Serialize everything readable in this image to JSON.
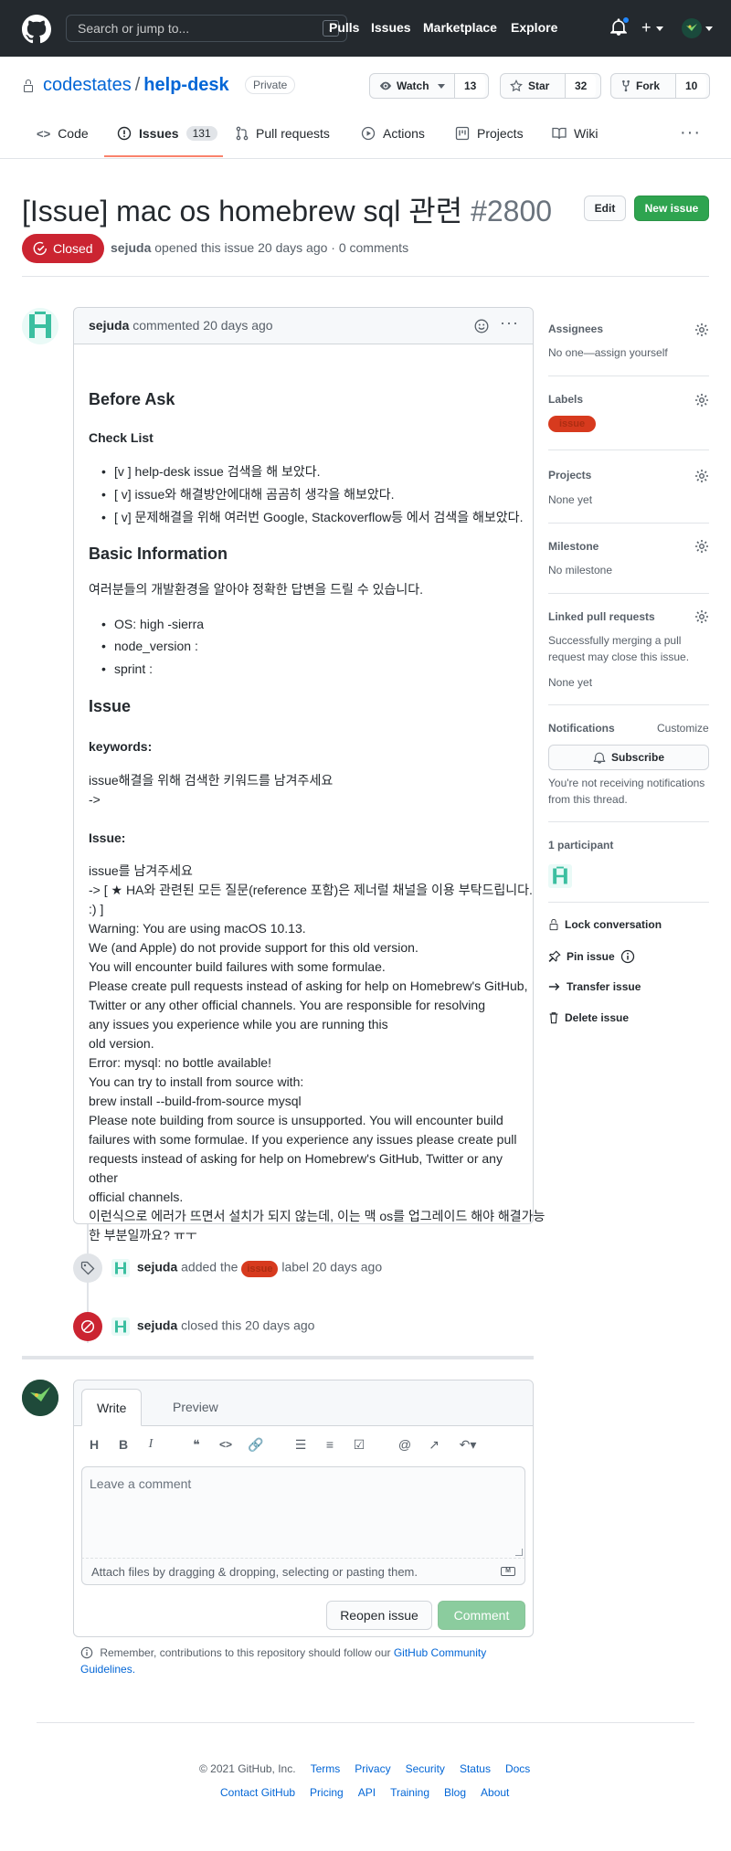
{
  "header": {
    "search_placeholder": "Search or jump to...",
    "search_key": "/",
    "nav": [
      "Pulls",
      "Issues",
      "Marketplace",
      "Explore"
    ]
  },
  "repo": {
    "owner": "codestates",
    "separator": "/",
    "name": "help-desk",
    "visibility": "Private",
    "watch_label": "Watch",
    "watch_count": "13",
    "star_label": "Star",
    "star_count": "32",
    "fork_label": "Fork",
    "fork_count": "10"
  },
  "repo_nav": {
    "code": "Code",
    "issues": "Issues",
    "issues_count": "131",
    "pulls": "Pull requests",
    "actions": "Actions",
    "projects": "Projects",
    "wiki": "Wiki"
  },
  "issue": {
    "title": "[Issue] mac os homebrew sql 관련",
    "number": "#2800",
    "edit_label": "Edit",
    "new_issue_label": "New issue",
    "state": "Closed",
    "author": "sejuda",
    "meta": "opened this issue 20 days ago · 0 comments"
  },
  "comment": {
    "author": "sejuda",
    "meta": "commented 20 days ago",
    "lines": {
      "before_ask": "Before Ask",
      "check_list": "Check List",
      "c1": "[v ] help-desk issue 검색을 해 보았다.",
      "c2": "[ v] issue와 해결방안에대해 곰곰히 생각을 해보았다.",
      "c3": "[ v] 문제해결을 위해 여러번 Google, Stackoverflow등 에서 검색을 해보았다.",
      "basic_info": "Basic Information",
      "basic_desc": "여러분들의 개발환경을 알아야 정확한 답변을 드릴 수 있습니다.",
      "os": "OS: high -sierra",
      "node": "node_version :",
      "sprint": "sprint :",
      "issue_h": "Issue",
      "keywords_h": "keywords:",
      "keywords_1": "issue해결을 위해 검색한 키워드를 남겨주세요",
      "keywords_2": "->",
      "issue_h2": "Issue:",
      "i1": "issue를 남겨주세요",
      "i2": "-> [ ★ HA와 관련된 모든 질문(reference 포함)은 제너럴 채널을 이용 부탁드립니다.",
      "i3": ":) ]",
      "i4": "Warning: You are using macOS 10.13.",
      "i5": "We (and Apple) do not provide support for this old version.",
      "i6": "You will encounter build failures with some formulae.",
      "i7": "Please create pull requests instead of asking for help on Homebrew's GitHub,",
      "i8": "Twitter or any other official channels. You are responsible for resolving",
      "i9": "any issues you experience while you are running this",
      "i10": "old version.",
      "i11": "Error: mysql: no bottle available!",
      "i12": "You can try to install from source with:",
      "i13": "brew install --build-from-source mysql",
      "i14": "Please note building from source is unsupported. You will encounter build",
      "i15": "failures with some formulae. If you experience any issues please create pull",
      "i16": "requests instead of asking for help on Homebrew's GitHub, Twitter or any",
      "i17": "other",
      "i18": "official channels.",
      "i19": "이런식으로 에러가 뜨면서 설치가 되지 않는데, 이는 맥 os를 업그레이드 해야 해결가능",
      "i20": "한 부분일까요? ㅠㅜ"
    }
  },
  "sidebar": {
    "assignees_h": "Assignees",
    "assignees_v": "No one—assign yourself",
    "labels_h": "Labels",
    "label_name": "issue",
    "projects_h": "Projects",
    "projects_v": "None yet",
    "milestone_h": "Milestone",
    "milestone_v": "No milestone",
    "linked_h": "Linked pull requests",
    "linked_desc1": "Successfully merging a pull",
    "linked_desc2": "request may close this issue.",
    "linked_v": "None yet",
    "notif_h": "Notifications",
    "customize": "Customize",
    "subscribe": "Subscribe",
    "notif_desc1": "You're not receiving notifications",
    "notif_desc2": "from this thread.",
    "participants": "1 participant",
    "lock": "Lock conversation",
    "pin": "Pin issue",
    "transfer": "Transfer issue",
    "delete": "Delete issue"
  },
  "timeline": {
    "label_event_user": "sejuda",
    "label_event_pre": "added the",
    "label_event_label": "issue",
    "label_event_post": "label 20 days ago",
    "closed_user": "sejuda",
    "closed_text": "closed this 20 days ago"
  },
  "compose": {
    "write_tab": "Write",
    "preview_tab": "Preview",
    "placeholder": "Leave a comment",
    "attach_hint": "Attach files by dragging & dropping, selecting or pasting them.",
    "reopen": "Reopen issue",
    "comment": "Comment",
    "remember_pre": "Remember, contributions to this repository should follow our",
    "guidelines_1": "GitHub Community",
    "guidelines_2": "Guidelines."
  },
  "footer": {
    "copyright": "© 2021 GitHub, Inc.",
    "row1": [
      "Terms",
      "Privacy",
      "Security",
      "Status",
      "Docs"
    ],
    "row2": [
      "Contact GitHub",
      "Pricing",
      "API",
      "Training",
      "Blog",
      "About"
    ]
  },
  "colors": {
    "header_bg": "#24292e",
    "link": "#0366d6",
    "closed_red": "#cb2431",
    "green": "#2ea44f",
    "label_orange": "#d73a1e"
  }
}
